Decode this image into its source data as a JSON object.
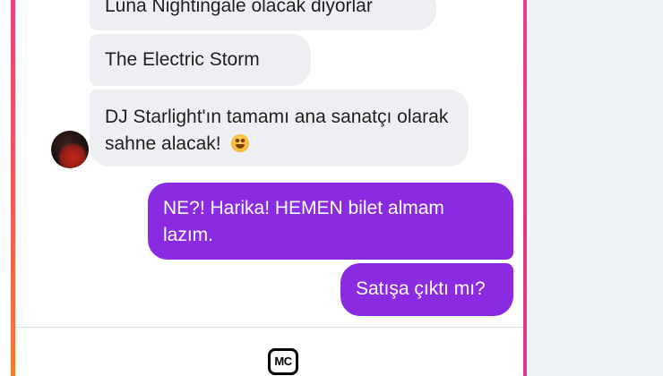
{
  "messages": [
    {
      "direction": "incoming",
      "text": "Luna Nightingale olacak diyorlar"
    },
    {
      "direction": "incoming",
      "text": "The Electric Storm"
    },
    {
      "direction": "incoming",
      "text": "DJ Starlight'ın tamamı ana sanatçı olarak sahne alacak!",
      "emoji": "star-struck-emoji"
    },
    {
      "direction": "outgoing",
      "text": "NE?! Harika! HEMEN bilet almam lazım."
    },
    {
      "direction": "outgoing",
      "text": "Satışa çıktı mı?"
    }
  ],
  "composer": {
    "logo_text": "MC",
    "logo_icon": "mc-logo-icon"
  },
  "colors": {
    "incoming_bubble": "#eeeff3",
    "outgoing_bubble": "#8a2be2",
    "frame_left_top": "#f03f78",
    "frame_left_bottom": "#f57a2f",
    "frame_right": "#e5357a",
    "right_panel": "#eef1f6"
  }
}
